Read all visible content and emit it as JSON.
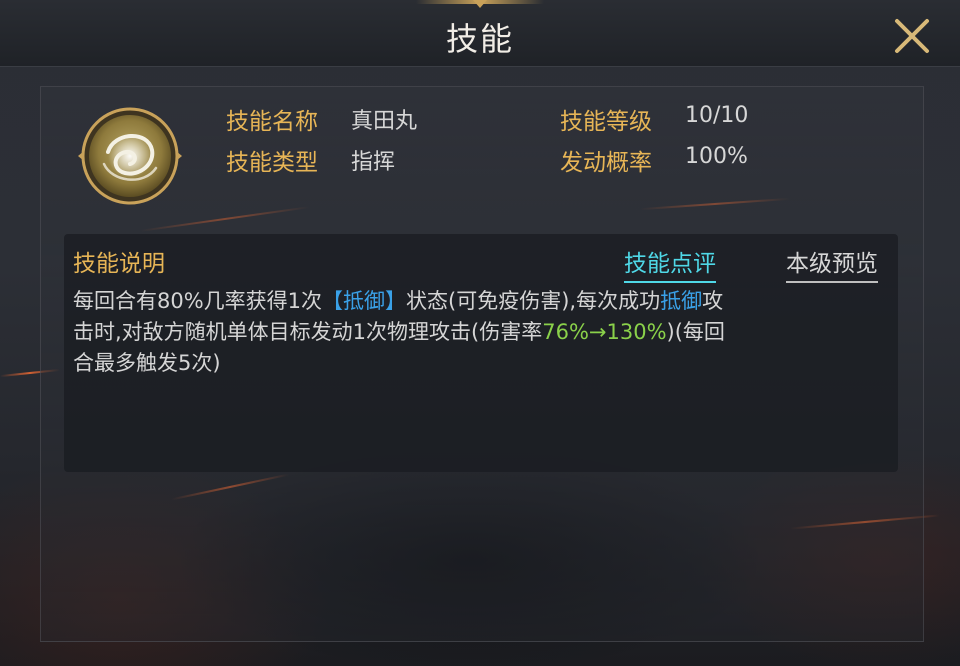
{
  "header": {
    "title": "技能"
  },
  "skill": {
    "icon_name": "swirl-skill-icon",
    "fields": [
      {
        "label": "技能名称",
        "value": "真田丸"
      },
      {
        "label": "技能类型",
        "value": "指挥"
      },
      {
        "label": "技能等级",
        "value": "10/10"
      },
      {
        "label": "发动概率",
        "value": "100%"
      }
    ]
  },
  "description": {
    "title": "技能说明",
    "review_link": "技能点评",
    "preview_link": "本级预览",
    "line1_a": "每回合有80%几率获得1次",
    "line1_tag": "【抵御】",
    "line1_b": "状态(可免疫伤害),每次成功",
    "line1_kw": "抵御",
    "line1_c": "攻",
    "line2_a": "击时,对敌方随机单体目标发动1次物理攻击(伤害率",
    "line2_rate": "76%→130%",
    "line2_b": ")(每回",
    "line3": "合最多触发5次)"
  },
  "colors": {
    "label_gold": "#e7b556",
    "keyword_blue": "#3aa1e8",
    "rate_green": "#8ad14a",
    "review_cyan": "#4fd8e7"
  }
}
